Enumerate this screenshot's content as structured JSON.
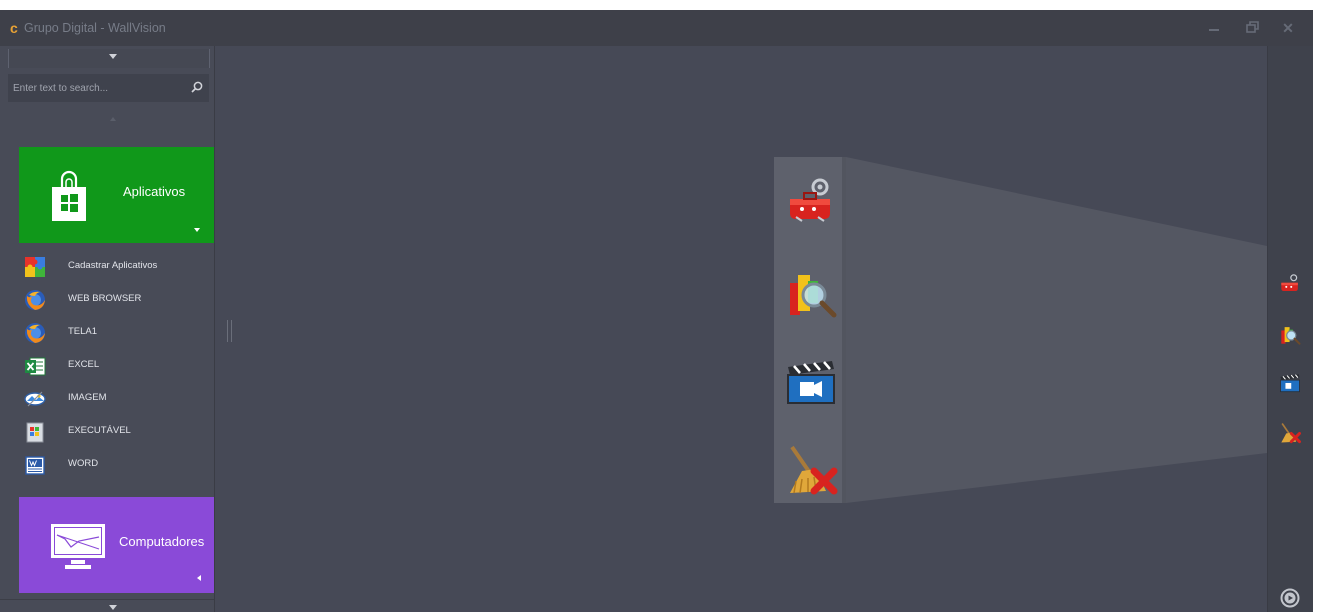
{
  "window": {
    "title": "Grupo Digital - WallVision",
    "app_icon_glyph": "c"
  },
  "sidebar": {
    "search": {
      "placeholder": "Enter text to search...",
      "value": ""
    },
    "groups": [
      {
        "label": "Aplicativos",
        "color": "#10981a",
        "icon": "store-icon",
        "items": [
          {
            "label": "Cadastrar Aplicativos",
            "icon": "puzzle-icon"
          },
          {
            "label": "WEB BROWSER",
            "icon": "firefox-icon"
          },
          {
            "label": "TELA1",
            "icon": "firefox-icon"
          },
          {
            "label": "EXCEL",
            "icon": "excel-icon"
          },
          {
            "label": "IMAGEM",
            "icon": "image-viewer-icon"
          },
          {
            "label": "EXECUTÁVEL",
            "icon": "executable-icon"
          },
          {
            "label": "WORD",
            "icon": "word-icon"
          }
        ]
      },
      {
        "label": "Computadores",
        "color": "#8a4ad8",
        "icon": "monitor-icon"
      }
    ]
  },
  "dock": {
    "icons": [
      "toolbox-icon",
      "search-report-icon",
      "video-clapper-icon",
      "broom-clear-icon"
    ],
    "bottom_icon": "play-icon"
  },
  "colors": {
    "background": "#464956",
    "titlebar": "#3e4049",
    "sidebar": "#484b57",
    "dock": "#3f424c",
    "accent_title_icon": "#e8a235"
  }
}
